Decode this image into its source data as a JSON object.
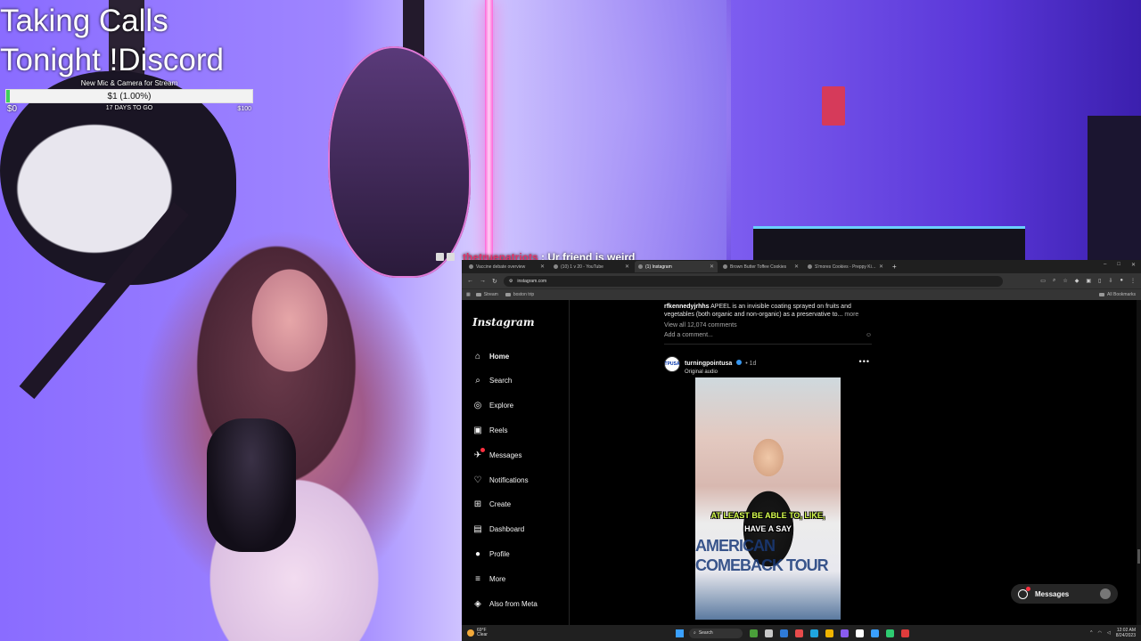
{
  "overlay": {
    "title_line1": "Taking Calls",
    "title_line2": "Tonight !Discord",
    "goal": {
      "name": "New Mic & Camera for Stream",
      "amount": "$1 (1.00%)",
      "progress_percent": 1.0,
      "min": "$0",
      "days": "17 DAYS TO GO",
      "max": "$100",
      "fill_color": "#3fd15d"
    },
    "chat": {
      "user": "thetruepatriots",
      "separator": " : ",
      "message": "Ur friend is weird"
    }
  },
  "browser": {
    "tabs": [
      {
        "title": "Vaccine debate overview",
        "active": false
      },
      {
        "title": "(10) 1 v 20 - YouTube",
        "active": false
      },
      {
        "title": "(1) Instagram",
        "active": true
      },
      {
        "title": "Brown Butter Toffee Cookies",
        "active": false
      },
      {
        "title": "S'mores Cookies - Preppy Kitch",
        "active": false
      }
    ],
    "new_tab": "+",
    "url": "instagram.com",
    "bookmarks": [
      {
        "label": "Stream"
      },
      {
        "label": "boston trip"
      }
    ],
    "all_bookmarks": "All Bookmarks"
  },
  "instagram": {
    "logo": "Instagram",
    "nav": [
      {
        "label": "Home",
        "icon": "home-icon",
        "glyph": "⌂",
        "bold": true
      },
      {
        "label": "Search",
        "icon": "search-icon",
        "glyph": "⌕"
      },
      {
        "label": "Explore",
        "icon": "compass-icon",
        "glyph": "◎"
      },
      {
        "label": "Reels",
        "icon": "reels-icon",
        "glyph": "▣"
      },
      {
        "label": "Messages",
        "icon": "messenger-icon",
        "glyph": "✈"
      },
      {
        "label": "Notifications",
        "icon": "heart-icon",
        "glyph": "♡"
      },
      {
        "label": "Create",
        "icon": "plus-square-icon",
        "glyph": "⊞"
      },
      {
        "label": "Dashboard",
        "icon": "dashboard-icon",
        "glyph": "▤"
      },
      {
        "label": "Profile",
        "icon": "profile-avatar-icon",
        "glyph": "●"
      },
      {
        "label": "More",
        "icon": "menu-icon",
        "glyph": "≡"
      },
      {
        "label": "Also from Meta",
        "icon": "meta-icon",
        "glyph": "◈"
      }
    ],
    "prev_post": {
      "user": "rfkennedyjrhhs",
      "caption": "APEEL is an invisible coating sprayed on fruits and vegetables (both organic and non-organic) as a preservative to...",
      "more": "more",
      "view_comments": "View all 12,074 comments",
      "add_comment": "Add a comment...",
      "emoji": "☺"
    },
    "post": {
      "user": "turningpointusa",
      "time": "• 1d",
      "audio": "Original audio",
      "avatar_text": "TPUSA",
      "menu": "•••",
      "caption_line1": "AT LEAST BE ABLE TO, LIKE,",
      "caption_line2": "HAVE A SAY",
      "banner_text": "AMERICAN COMEBACK TOUR"
    },
    "messages_pill": "Messages"
  },
  "taskbar": {
    "weather_temp": "69°F",
    "weather_desc": "Clear",
    "search": "Search",
    "time": "12:02 AM",
    "date": "8/24/2023",
    "app_colors": [
      "#4a9f3a",
      "#c9c9c9",
      "#2f7bd8",
      "#e84b4b",
      "#1fa5e0",
      "#f0b400",
      "#8a5cf0",
      "#ffffff",
      "#3aa0ff",
      "#2ecc71",
      "#e03c3c"
    ]
  }
}
